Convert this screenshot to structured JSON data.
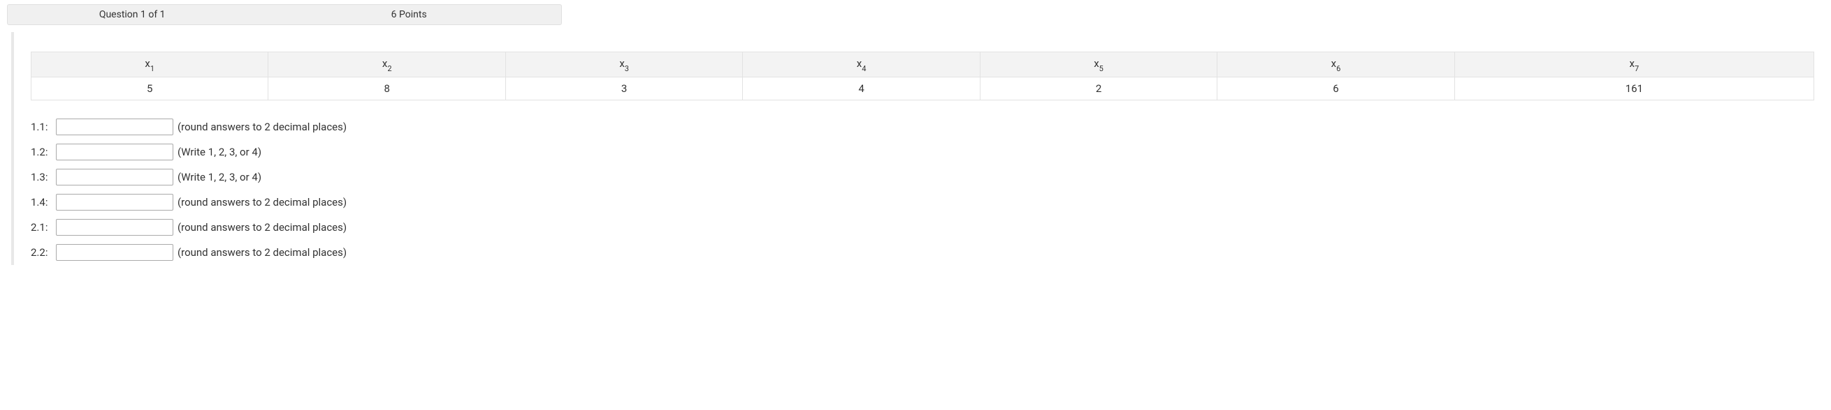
{
  "header": {
    "question_label": "Question 1 of 1",
    "points_label": "6 Points"
  },
  "table": {
    "headers": [
      {
        "base": "x",
        "sub": "1"
      },
      {
        "base": "x",
        "sub": "2"
      },
      {
        "base": "x",
        "sub": "3"
      },
      {
        "base": "x",
        "sub": "4"
      },
      {
        "base": "x",
        "sub": "5"
      },
      {
        "base": "x",
        "sub": "6"
      },
      {
        "base": "x",
        "sub": "7"
      }
    ],
    "values": [
      "5",
      "8",
      "3",
      "4",
      "2",
      "6",
      "161"
    ]
  },
  "answers": [
    {
      "label": "1.1:",
      "value": "",
      "hint": "(round answers to 2 decimal places)"
    },
    {
      "label": "1.2:",
      "value": "",
      "hint": "(Write 1, 2, 3, or 4)"
    },
    {
      "label": "1.3:",
      "value": "",
      "hint": "(Write 1, 2, 3, or 4)"
    },
    {
      "label": "1.4:",
      "value": "",
      "hint": "(round answers to 2 decimal places)"
    },
    {
      "label": "2.1:",
      "value": "",
      "hint": "(round answers to 2 decimal places)"
    },
    {
      "label": "2.2:",
      "value": "",
      "hint": "(round answers to 2 decimal places)"
    }
  ]
}
